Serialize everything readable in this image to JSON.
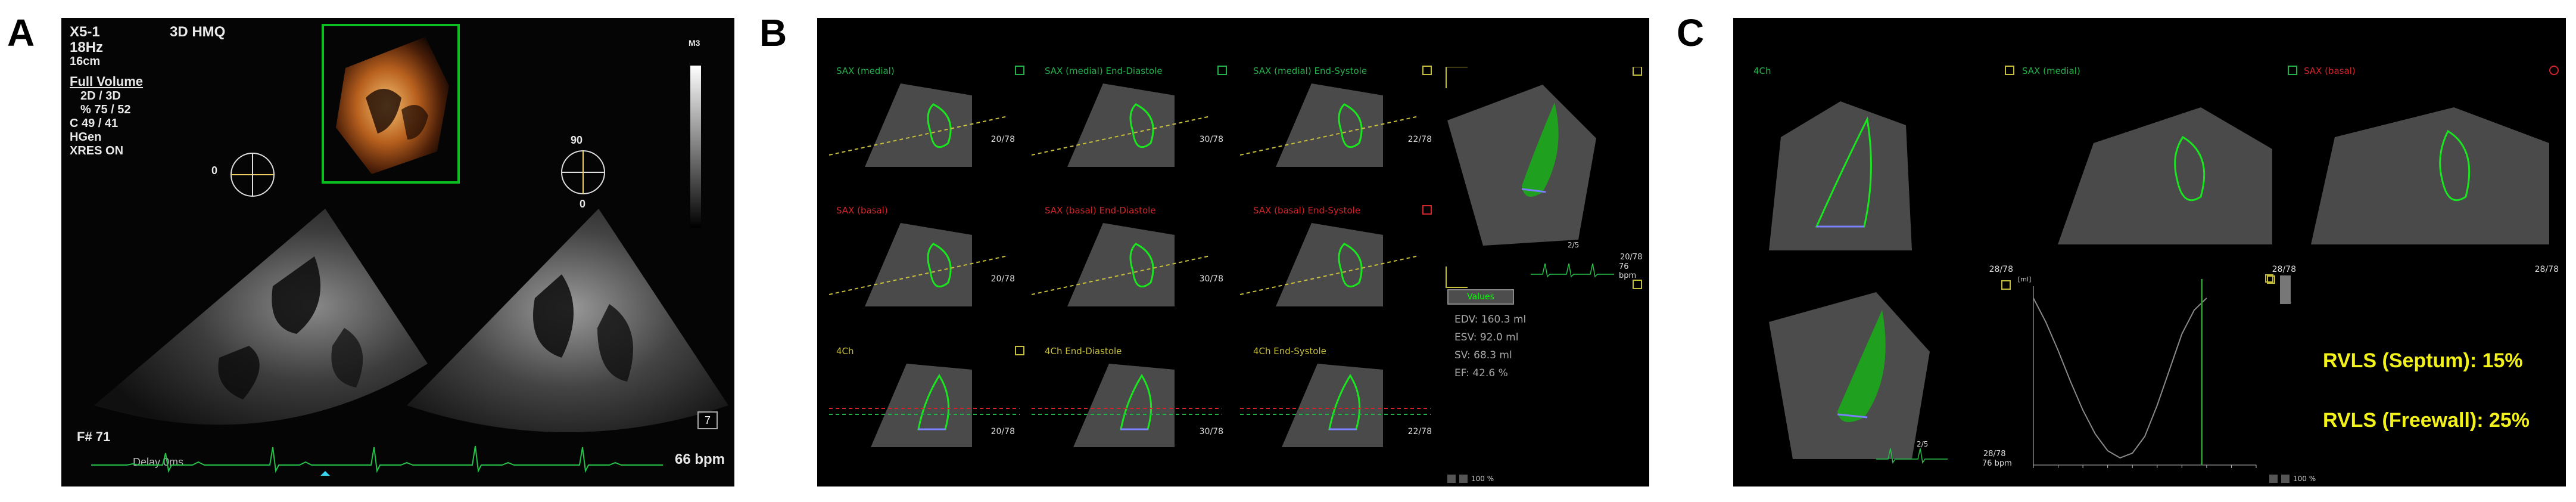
{
  "letters": {
    "a": "A",
    "b": "B",
    "c": "C"
  },
  "panelA": {
    "probe": "X5-1",
    "rate": "18Hz",
    "depth": "16cm",
    "mode": "3D  HMQ",
    "full_volume": "Full Volume",
    "settings": [
      "2D / 3D",
      "% 75 / 52",
      "C  49 / 41",
      "HGen",
      "XRES ON"
    ],
    "angle_left": "0",
    "angle_right_top": "90",
    "angle_right_bottom": "0",
    "gray_bar_label": "M3",
    "frame": "F# 71",
    "delay": "Delay 0ms",
    "hr": "66 bpm",
    "badge": "7"
  },
  "panelB": {
    "cells": [
      {
        "title": "SAX (medial)",
        "color": "green",
        "frame": "20/78"
      },
      {
        "title": "SAX (medial) End-Diastole",
        "color": "green",
        "frame": "30/78"
      },
      {
        "title": "SAX (medial) End-Systole",
        "color": "green",
        "frame": "22/78"
      },
      {
        "title": "SAX (basal)",
        "color": "red",
        "frame": "20/78"
      },
      {
        "title": "SAX (basal) End-Diastole",
        "color": "red",
        "frame": "30/78"
      },
      {
        "title": "SAX (basal) End-Systole",
        "color": "red",
        "frame": "22/78"
      },
      {
        "title": "4Ch",
        "color": "olive",
        "frame": "20/78"
      },
      {
        "title": "4Ch End-Diastole",
        "color": "olive",
        "frame": "30/78"
      },
      {
        "title": "4Ch End-Systole",
        "color": "olive",
        "frame": "22/78"
      }
    ],
    "volume_frame": "20/78",
    "volume_bpm": "76 bpm",
    "mini_frame": "2/5",
    "button": "Values",
    "metrics": [
      "EDV: 160.3 ml",
      "ESV: 92.0 ml",
      "SV: 68.3 ml",
      "EF: 42.6 %"
    ],
    "zoom": "100 %"
  },
  "panelC": {
    "cells": [
      {
        "title": "4Ch",
        "color": "green",
        "frame": "28/78"
      },
      {
        "title": "SAX (medial)",
        "color": "green",
        "frame": "28/78"
      },
      {
        "title": "SAX (basal)",
        "color": "red",
        "frame": "28/78"
      }
    ],
    "volume_frame": "28/78",
    "volume_bpm": "76 bpm",
    "mini_frame": "2/5",
    "chart_unit": "[ml]",
    "zoom": "100 %",
    "rvls_septum": "RVLS (Septum): 15%",
    "rvls_freewall": "RVLS (Freewall): 25%"
  },
  "chart_data": {
    "type": "line",
    "title": "",
    "xlabel": "",
    "ylabel": "[ml]",
    "ylim": [
      90,
      165
    ],
    "xlim": [
      0,
      900
    ],
    "x": [
      0,
      50,
      100,
      150,
      200,
      250,
      300,
      350,
      400,
      450,
      500,
      550,
      600,
      650,
      700
    ],
    "series": [
      {
        "values": [
          160,
          150,
          138,
          125,
          113,
          103,
          96,
          93,
          95,
          102,
          115,
          130,
          145,
          155,
          160
        ]
      }
    ],
    "marker_x": 680
  },
  "colors": {
    "ecg_green": "#25c24a",
    "contour_green": "#19e61e",
    "volume_green": "#1fa11f",
    "rvls_yellow": "#f2f21a",
    "frame_green": "#0bbf20"
  }
}
